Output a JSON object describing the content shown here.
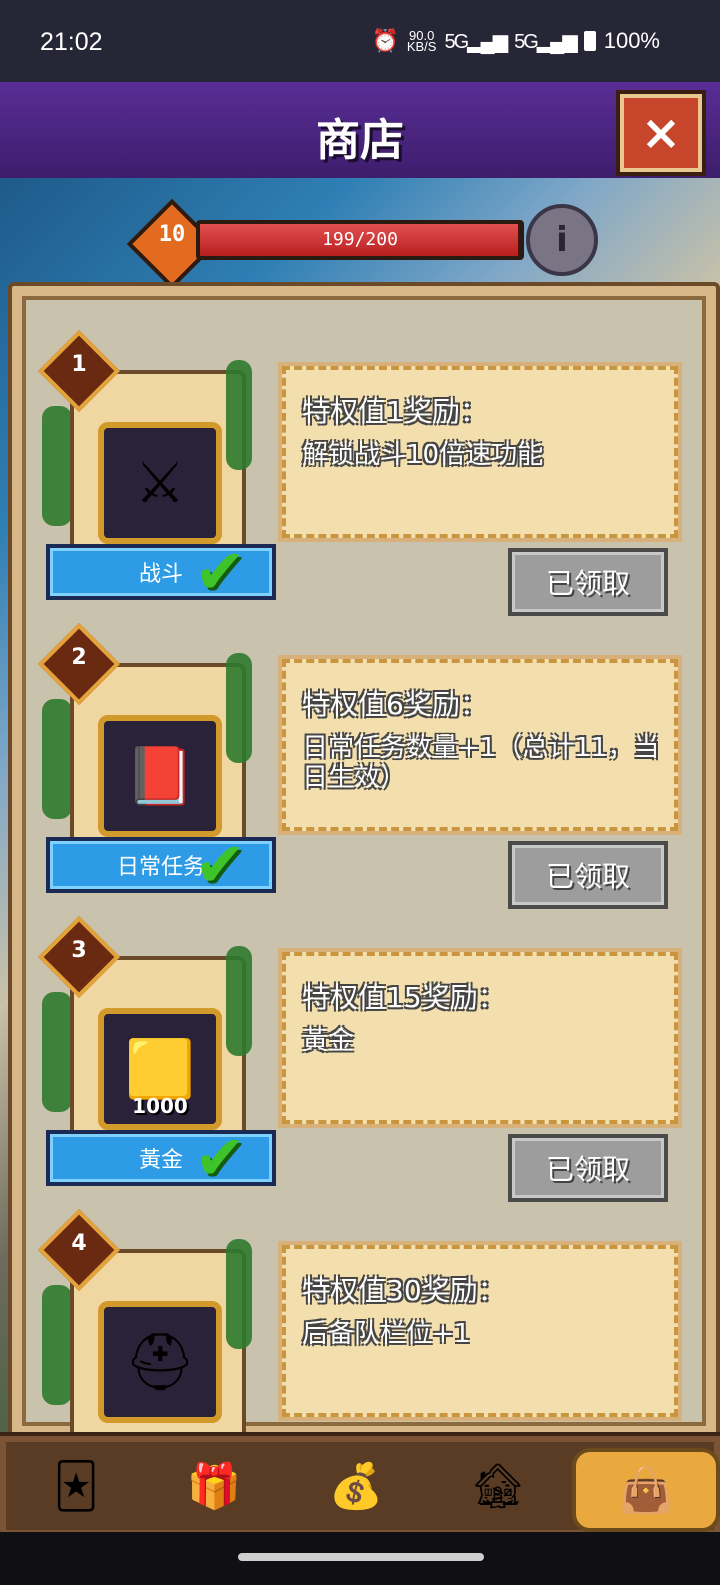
{
  "status_bar": {
    "time": "21:02",
    "net_speed_value": "90.0",
    "net_speed_unit": "KB/S",
    "signal1": "5G",
    "signal2": "5G",
    "battery": "100%"
  },
  "header": {
    "title": "商店",
    "close_icon": "×"
  },
  "level": {
    "level_number": "10",
    "xp_text": "199/200",
    "xp_progress": 0.995
  },
  "rewards": [
    {
      "index": "1",
      "card_label": "战斗",
      "amount": "",
      "icon": "⚔",
      "title": "特权值1奖励：",
      "body": "解锁战斗10倍速功能",
      "button": "已领取",
      "claimed": true
    },
    {
      "index": "2",
      "card_label": "日常任务",
      "amount": "",
      "icon": "📕",
      "title": "特权值6奖励：",
      "body": "日常任务数量+1（总计11，当日生效）",
      "button": "已领取",
      "claimed": true
    },
    {
      "index": "3",
      "card_label": "黃金",
      "amount": "1000",
      "icon": "🟨",
      "title": "特权值15奖励：",
      "body": "黃金",
      "button": "已领取",
      "claimed": true
    },
    {
      "index": "4",
      "card_label": "",
      "amount": "",
      "icon": "⛑",
      "title": "特权值30奖励：",
      "body": "后备队栏位+1",
      "button": "",
      "claimed": false
    }
  ],
  "bottom_nav": [
    {
      "name": "card-deck-icon",
      "glyph": "🃏"
    },
    {
      "name": "gift-box-icon",
      "glyph": "🎁"
    },
    {
      "name": "treasure-chest-icon",
      "glyph": "💰"
    },
    {
      "name": "barracks-icon",
      "glyph": "🏚"
    },
    {
      "name": "vip-bag-icon",
      "glyph": "👜"
    }
  ]
}
